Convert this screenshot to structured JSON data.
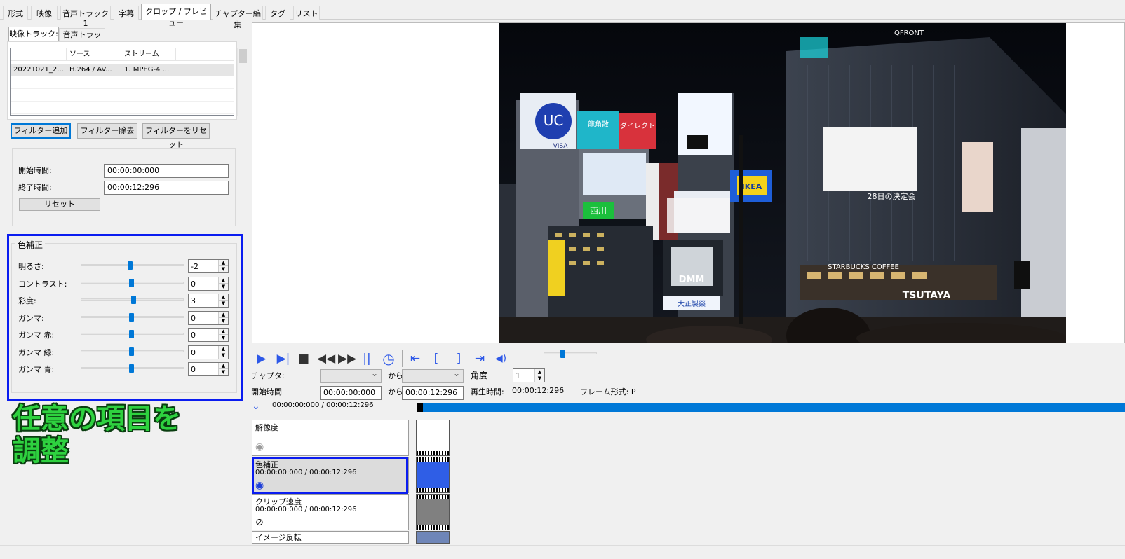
{
  "tabs": [
    "形式",
    "映像",
    "音声トラック 1",
    "字幕",
    "クロップ / プレビュー",
    "チャプター編集",
    "タグ",
    "リスト"
  ],
  "active_tab": "クロップ / プレビュー",
  "track_tabs": [
    "映像トラック:",
    "音声トラック:"
  ],
  "track_table": {
    "headers": [
      "",
      "ソース",
      "ストリーム"
    ],
    "rows": [
      [
        "20221021_2...",
        "H.264 / AV...",
        "1. MPEG-4 ..."
      ]
    ]
  },
  "filter_buttons": {
    "add": "フィルター追加",
    "remove": "フィルター除去",
    "reset": "フィルターをリセット"
  },
  "time_range": {
    "start_label": "開始時間:",
    "start_value": "00:00:00:000",
    "end_label": "終了時間:",
    "end_value": "00:00:12:296",
    "reset_label": "リセット"
  },
  "color_correction": {
    "title": "色補正",
    "params": [
      {
        "label": "明るさ:",
        "value": "-2",
        "level": -2
      },
      {
        "label": "コントラスト:",
        "value": "0",
        "level": 0
      },
      {
        "label": "彩度:",
        "value": "3",
        "level": 3
      },
      {
        "label": "ガンマ:",
        "value": "0",
        "level": 0
      },
      {
        "label": "ガンマ 赤:",
        "value": "0",
        "level": 0
      },
      {
        "label": "ガンマ 緑:",
        "value": "0",
        "level": 0
      },
      {
        "label": "ガンマ 青:",
        "value": "0",
        "level": 0
      }
    ]
  },
  "callout": {
    "line1": "任意の項目を",
    "line2": "調整",
    "color": "#2ed13f"
  },
  "preview": {
    "signs": {
      "uc": "UC",
      "visa": "VISA",
      "kinwan1": "龍角散",
      "kinwan2": "ダイレクト",
      "ikea": "IKEA",
      "dmm": "DMM",
      "qfront": "QFRONT",
      "starbucks": "STARBUCKS COFFEE",
      "tsutaya": "TSUTAYA",
      "kenmei": "28日の決定会",
      "nishi": "西川",
      "taisho": "大正製薬"
    }
  },
  "player": {
    "chapter_label": "チャプタ:",
    "from1": "から",
    "angle_label": "角度",
    "angle_value": "1",
    "start_label": "開始時間",
    "start_value": "00:00:00:000",
    "from2": "から",
    "end_value": "00:00:12:296",
    "play_time_label": "再生時間:",
    "play_time_value": "00:00:12:296",
    "frame_label": "フレーム形式: P",
    "position": "00:00:00:000 / 00:00:12:296"
  },
  "filters": [
    {
      "name": "解像度",
      "time": ""
    },
    {
      "name": "色補正",
      "time": "00:00:00:000 / 00:00:12:296"
    },
    {
      "name": "クリップ速度",
      "time": "00:00:00:000 / 00:00:12:296"
    },
    {
      "name": "イメージ反転",
      "time": ""
    }
  ],
  "colors": {
    "accent": "#0078d7",
    "highlight": "#0a1cf0",
    "icon": "#2d58e8"
  }
}
